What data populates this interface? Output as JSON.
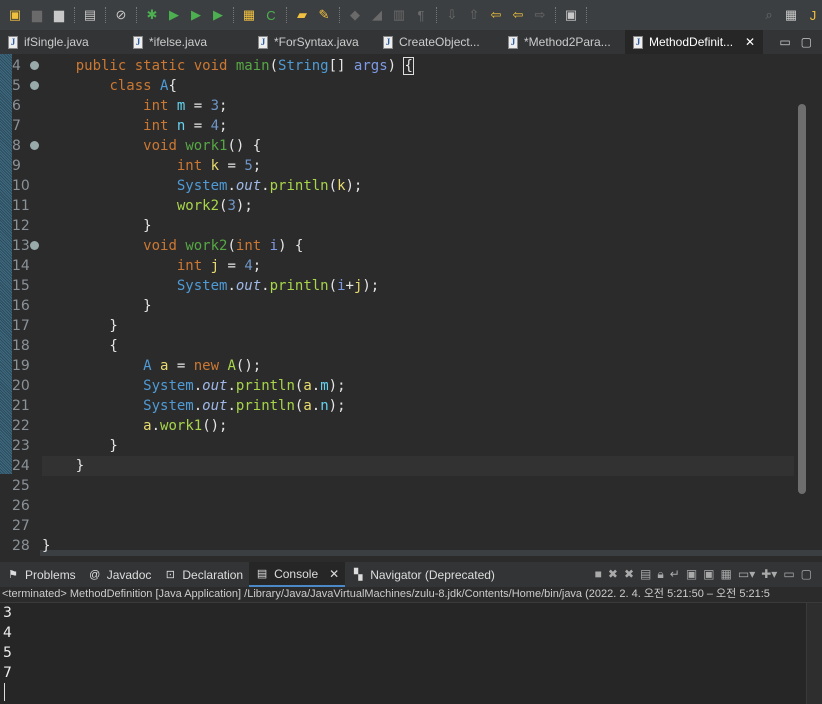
{
  "toolbar": {
    "icons": [
      "new-icon",
      "save-icon",
      "save-all-icon",
      "terminal-icon",
      "skip-breakpoints-icon",
      "debug-icon",
      "run-icon",
      "coverage-icon",
      "external-tools-icon",
      "new-package-icon",
      "new-class-icon",
      "open-type-icon",
      "highlight-icon",
      "annotation-icon",
      "block-selection-icon",
      "word-wrap-icon",
      "show-whitespace-icon",
      "next-annotation-icon",
      "prev-annotation-icon",
      "last-edit-icon",
      "back-icon",
      "forward-icon",
      "perspective-icon",
      "search-icon",
      "open-perspective-icon",
      "java-perspective-icon"
    ]
  },
  "editor_tabs": [
    {
      "label": "ifSingle.java",
      "icon": "java-file-error-icon"
    },
    {
      "label": "*ifelse.java",
      "icon": "java-file-icon"
    },
    {
      "label": "*ForSyntax.java",
      "icon": "java-file-warning-icon"
    },
    {
      "label": "CreateObject...",
      "icon": "java-file-icon"
    },
    {
      "label": "*Method2Para...",
      "icon": "java-file-icon"
    },
    {
      "label": "MethodDefinit...",
      "icon": "java-file-icon",
      "active": true
    }
  ],
  "editor": {
    "current_line": 24,
    "lines": [
      {
        "n": "4",
        "fold": true,
        "t": [
          [
            "",
            "    "
          ],
          [
            "kw",
            "public static void "
          ],
          [
            "fn",
            "main"
          ],
          [
            "",
            "("
          ],
          [
            "ty",
            "String"
          ],
          [
            "",
            "[] "
          ],
          [
            "pa",
            "args"
          ],
          [
            "",
            ") "
          ],
          [
            "box",
            "{"
          ]
        ]
      },
      {
        "n": "5",
        "fold": true,
        "t": [
          [
            "",
            "        "
          ],
          [
            "kw",
            "class "
          ],
          [
            "ty",
            "A"
          ],
          [
            "",
            "{"
          ]
        ]
      },
      {
        "n": "6",
        "t": [
          [
            "",
            "            "
          ],
          [
            "kw",
            "int "
          ],
          [
            "fi",
            "m"
          ],
          [
            "",
            " = "
          ],
          [
            "nu",
            "3"
          ],
          [
            "",
            ";"
          ]
        ]
      },
      {
        "n": "7",
        "t": [
          [
            "",
            "            "
          ],
          [
            "kw",
            "int "
          ],
          [
            "fi",
            "n"
          ],
          [
            "",
            " = "
          ],
          [
            "nu",
            "4"
          ],
          [
            "",
            ";"
          ]
        ]
      },
      {
        "n": "8",
        "fold": true,
        "t": [
          [
            "",
            "            "
          ],
          [
            "kw",
            "void "
          ],
          [
            "fn",
            "work1"
          ],
          [
            "",
            "() {"
          ]
        ]
      },
      {
        "n": "9",
        "t": [
          [
            "",
            "                "
          ],
          [
            "kw",
            "int "
          ],
          [
            "lo",
            "k"
          ],
          [
            "",
            " = "
          ],
          [
            "nu",
            "5"
          ],
          [
            "",
            ";"
          ]
        ]
      },
      {
        "n": "10",
        "t": [
          [
            "",
            "                "
          ],
          [
            "ty",
            "System"
          ],
          [
            "",
            "."
          ],
          [
            "st",
            "out"
          ],
          [
            "",
            "."
          ],
          [
            "call",
            "println"
          ],
          [
            "",
            "("
          ],
          [
            "lo",
            "k"
          ],
          [
            "",
            ");"
          ]
        ]
      },
      {
        "n": "11",
        "t": [
          [
            "",
            "                "
          ],
          [
            "call",
            "work2"
          ],
          [
            "",
            "("
          ],
          [
            "nu",
            "3"
          ],
          [
            "",
            ");"
          ]
        ]
      },
      {
        "n": "12",
        "t": [
          [
            "",
            "            }"
          ]
        ]
      },
      {
        "n": "13",
        "fold": true,
        "t": [
          [
            "",
            "            "
          ],
          [
            "kw",
            "void "
          ],
          [
            "fn",
            "work2"
          ],
          [
            "",
            "("
          ],
          [
            "kw",
            "int "
          ],
          [
            "pa",
            "i"
          ],
          [
            "",
            ") {"
          ]
        ]
      },
      {
        "n": "14",
        "t": [
          [
            "",
            "                "
          ],
          [
            "kw",
            "int "
          ],
          [
            "lo",
            "j"
          ],
          [
            "",
            " = "
          ],
          [
            "nu",
            "4"
          ],
          [
            "",
            ";"
          ]
        ]
      },
      {
        "n": "15",
        "t": [
          [
            "",
            "                "
          ],
          [
            "ty",
            "System"
          ],
          [
            "",
            "."
          ],
          [
            "st",
            "out"
          ],
          [
            "",
            "."
          ],
          [
            "call",
            "println"
          ],
          [
            "",
            "("
          ],
          [
            "pa",
            "i"
          ],
          [
            "",
            "+"
          ],
          [
            "lo",
            "j"
          ],
          [
            "",
            ");"
          ]
        ]
      },
      {
        "n": "16",
        "t": [
          [
            "",
            "            }"
          ]
        ]
      },
      {
        "n": "17",
        "t": [
          [
            "",
            "        }"
          ]
        ]
      },
      {
        "n": "18",
        "t": [
          [
            "",
            "        {"
          ]
        ]
      },
      {
        "n": "19",
        "t": [
          [
            "",
            "            "
          ],
          [
            "ty",
            "A "
          ],
          [
            "lo",
            "a"
          ],
          [
            "",
            " = "
          ],
          [
            "kw",
            "new "
          ],
          [
            "call",
            "A"
          ],
          [
            "",
            "();"
          ]
        ]
      },
      {
        "n": "20",
        "t": [
          [
            "",
            "            "
          ],
          [
            "ty",
            "System"
          ],
          [
            "",
            "."
          ],
          [
            "st",
            "out"
          ],
          [
            "",
            "."
          ],
          [
            "call",
            "println"
          ],
          [
            "",
            "("
          ],
          [
            "lo",
            "a"
          ],
          [
            "",
            "."
          ],
          [
            "fi",
            "m"
          ],
          [
            "",
            ");"
          ]
        ]
      },
      {
        "n": "21",
        "t": [
          [
            "",
            "            "
          ],
          [
            "ty",
            "System"
          ],
          [
            "",
            "."
          ],
          [
            "st",
            "out"
          ],
          [
            "",
            "."
          ],
          [
            "call",
            "println"
          ],
          [
            "",
            "("
          ],
          [
            "lo",
            "a"
          ],
          [
            "",
            "."
          ],
          [
            "fi",
            "n"
          ],
          [
            "",
            ");"
          ]
        ]
      },
      {
        "n": "22",
        "t": [
          [
            "",
            "            "
          ],
          [
            "lo",
            "a"
          ],
          [
            "",
            "."
          ],
          [
            "call",
            "work1"
          ],
          [
            "",
            "();"
          ]
        ]
      },
      {
        "n": "23",
        "t": [
          [
            "",
            "        }"
          ]
        ]
      },
      {
        "n": "24",
        "t": [
          [
            "",
            "    }"
          ]
        ]
      },
      {
        "n": "25",
        "t": []
      },
      {
        "n": "26",
        "t": []
      },
      {
        "n": "27",
        "t": []
      },
      {
        "n": "28",
        "t": [
          [
            "",
            "}"
          ]
        ]
      }
    ]
  },
  "console_tabs": [
    {
      "label": "Problems",
      "icon": "problems-icon"
    },
    {
      "label": "Javadoc",
      "icon": "javadoc-icon"
    },
    {
      "label": "Declaration",
      "icon": "declaration-icon"
    },
    {
      "label": "Console",
      "icon": "console-icon",
      "active": true
    },
    {
      "label": "Navigator (Deprecated)",
      "icon": "navigator-icon"
    }
  ],
  "console": {
    "header": "<terminated> MethodDefinition [Java Application] /Library/Java/JavaVirtualMachines/zulu-8.jdk/Contents/Home/bin/java  (2022. 2. 4. 오전 5:21:50 – 오전 5:21:5",
    "output": [
      "3",
      "4",
      "5",
      "7"
    ]
  }
}
